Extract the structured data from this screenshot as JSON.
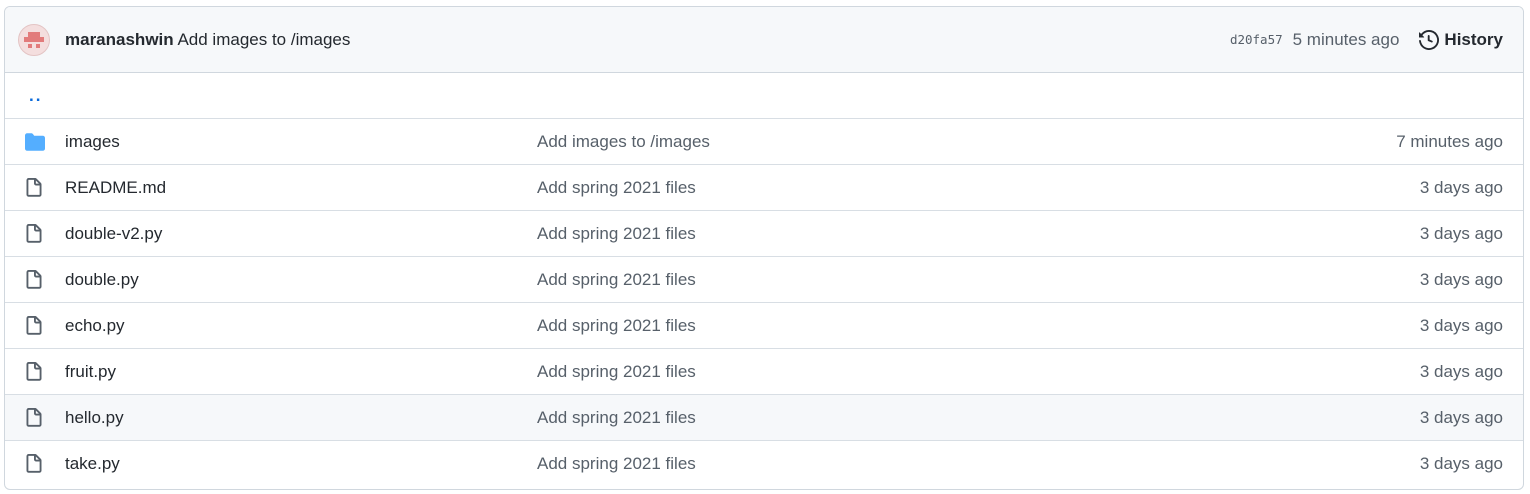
{
  "commit": {
    "author": "maranashwin",
    "message": "Add images to /images",
    "sha": "d20fa57",
    "time": "5 minutes ago",
    "history_label": "History"
  },
  "parent_link": "..",
  "files": [
    {
      "name": "images",
      "type": "folder",
      "message": "Add images to /images",
      "age": "7 minutes ago"
    },
    {
      "name": "README.md",
      "type": "file",
      "message": "Add spring 2021 files",
      "age": "3 days ago"
    },
    {
      "name": "double-v2.py",
      "type": "file",
      "message": "Add spring 2021 files",
      "age": "3 days ago"
    },
    {
      "name": "double.py",
      "type": "file",
      "message": "Add spring 2021 files",
      "age": "3 days ago"
    },
    {
      "name": "echo.py",
      "type": "file",
      "message": "Add spring 2021 files",
      "age": "3 days ago"
    },
    {
      "name": "fruit.py",
      "type": "file",
      "message": "Add spring 2021 files",
      "age": "3 days ago"
    },
    {
      "name": "hello.py",
      "type": "file",
      "message": "Add spring 2021 files",
      "age": "3 days ago"
    },
    {
      "name": "take.py",
      "type": "file",
      "message": "Add spring 2021 files",
      "age": "3 days ago"
    }
  ],
  "icons": {
    "folder": "folder-icon",
    "file": "file-icon",
    "history": "history-icon",
    "avatar": "avatar-identicon"
  },
  "colors": {
    "folder": "#54aeff",
    "link": "#0969da",
    "file_icon": "#57606a",
    "avatar_bg": "#f4dede",
    "avatar_fg": "#e27b7b"
  }
}
